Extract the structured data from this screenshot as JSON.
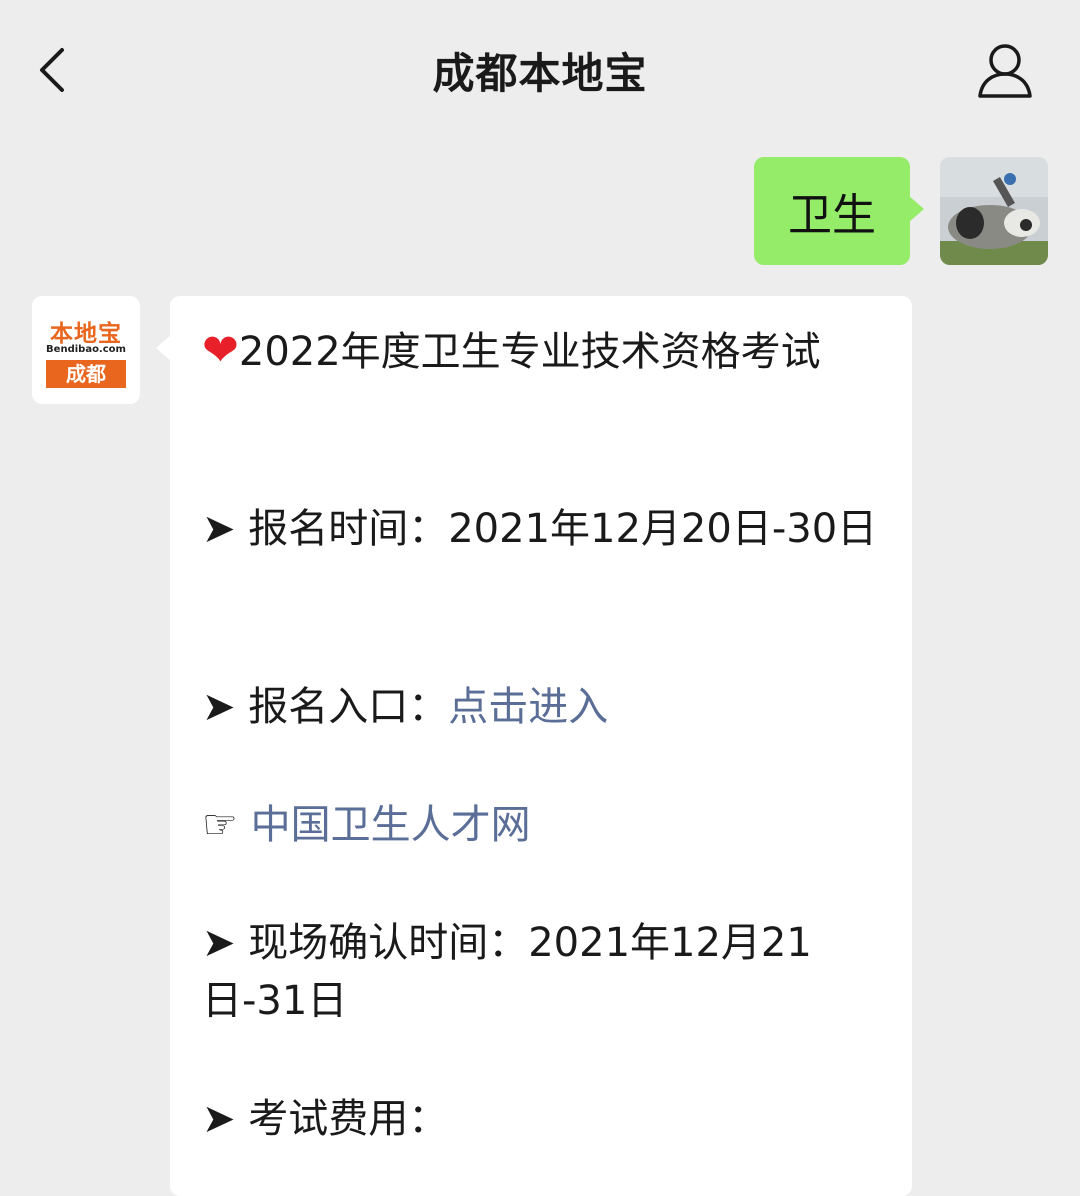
{
  "header": {
    "title": "成都本地宝"
  },
  "chat": {
    "outgoing": {
      "text": "卫生"
    },
    "bot": {
      "logo_top": "本地宝",
      "logo_domain": "Bendibao.com",
      "logo_city": "成都",
      "heart": "❤",
      "headline": "2022年度卫生专业技术资格考试",
      "arrow": "➤",
      "hand": "☞",
      "reg_time_label": "报名时间：",
      "reg_time_value": "2021年12月20日-30日",
      "reg_entry_label": "报名入口：",
      "reg_entry_link": "点击进入",
      "site_link": "中国卫生人才网",
      "confirm_label": "现场确认时间：",
      "confirm_value": "2021年12月21日-31日",
      "fee_label": "考试费用："
    }
  },
  "colors": {
    "background": "#ededed",
    "outgoing_bubble": "#95ec69",
    "bot_bubble": "#ffffff",
    "link": "#5a6e97",
    "logo_orange": "#e8661e"
  },
  "icons": {
    "back": "chevron-left-icon",
    "profile": "person-icon"
  }
}
